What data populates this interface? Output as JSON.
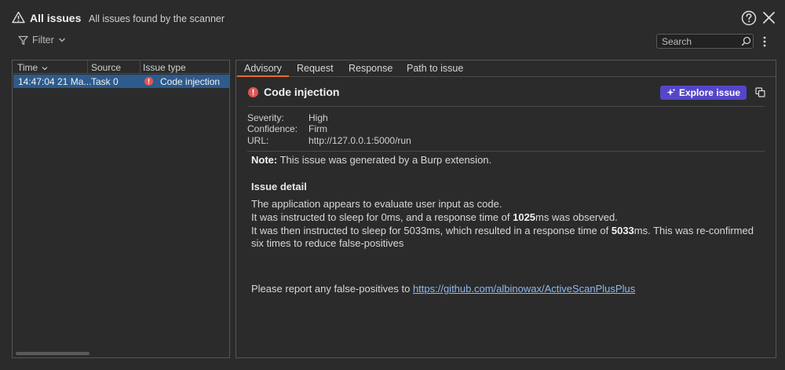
{
  "header": {
    "title": "All issues",
    "subtitle": "All issues found by the scanner"
  },
  "toolbar": {
    "filter_label": "Filter",
    "search_placeholder": "Search"
  },
  "table": {
    "columns": [
      "Time",
      "Source",
      "Issue type"
    ],
    "rows": [
      {
        "time": "14:47:04 21 Ma...",
        "source": "Task 0",
        "issue_type": "Code injection"
      }
    ]
  },
  "advisory": {
    "tabs": [
      "Advisory",
      "Request",
      "Response",
      "Path to issue"
    ],
    "active_tab": "Advisory",
    "issue_title": "Code injection",
    "explore_label": "Explore issue",
    "meta": [
      {
        "label": "Severity:",
        "value": "High"
      },
      {
        "label": "Confidence:",
        "value": "Firm"
      },
      {
        "label": "URL:",
        "value": "http://127.0.0.1:5000/run"
      }
    ],
    "note_label": "Note:",
    "note_text": " This issue was generated by a Burp extension.",
    "detail_heading": "Issue detail",
    "line1": "The application appears to evaluate user input as code.",
    "line2_pre": "It was instructed to sleep for 0ms, and a response time of ",
    "line2_bold": "1025",
    "line2_post": "ms was observed.",
    "line3_pre": "It was then instructed to sleep for 5033ms, which resulted in a response time of ",
    "line3_bold": "5033",
    "line3_post": "ms. This was re-confirmed",
    "line4": "six times to reduce false-positives",
    "report_pre": "Please report any false-positives to ",
    "report_link": "https://github.com/albinowax/ActiveScanPlusPlus"
  },
  "colors": {
    "accent_tab": "#e86a2c",
    "explore_button": "#5546c8",
    "selected_row": "#2d5b8c",
    "severity_high": "#e05555"
  }
}
